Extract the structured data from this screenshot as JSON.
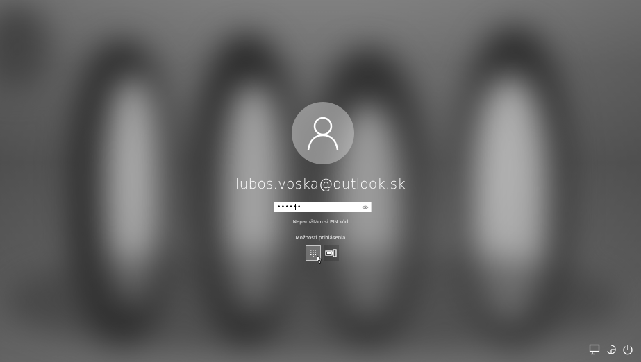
{
  "user": {
    "name": "lubos.voska@outlook.sk",
    "avatar_icon": "user-icon"
  },
  "pin": {
    "value": "••••••",
    "reveal_icon": "eye-icon"
  },
  "links": {
    "forgot_pin": "Nepamätám si PIN kód",
    "sign_in_options": "Možnosti prihlásenia"
  },
  "sign_in_options": [
    {
      "icon": "pin-keypad-icon",
      "selected": true
    },
    {
      "icon": "security-key-icon",
      "selected": false
    }
  ],
  "system_icons": [
    "network-icon",
    "ease-of-access-icon",
    "power-icon"
  ]
}
